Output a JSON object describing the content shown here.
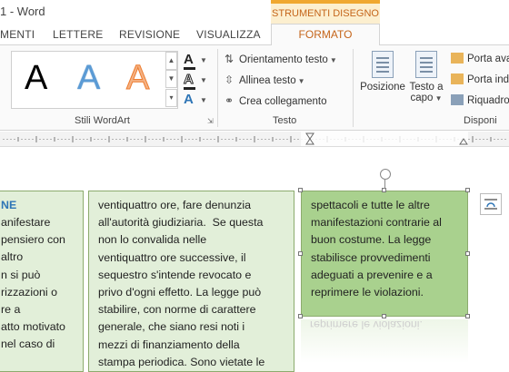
{
  "window": {
    "title": "1 - Word"
  },
  "context_group": "STRUMENTI DISEGNO",
  "tabs": [
    "MENTI",
    "LETTERE",
    "REVISIONE",
    "VISUALIZZA"
  ],
  "active_tab": "FORMATO",
  "ribbon": {
    "wordart": {
      "group_label": "Stili WordArt",
      "sample": "A"
    },
    "text": {
      "group_label": "Testo",
      "orientation": "Orientamento testo",
      "align": "Allinea testo",
      "link": "Crea collegamento"
    },
    "arrange": {
      "group_label": "Disponi",
      "position_label": "Posizione",
      "wrap_line1": "Testo a",
      "wrap_line2": "capo",
      "bring_forward": "Porta ava",
      "send_backward": "Porta ind",
      "selection_pane": "Riquadro"
    }
  },
  "document": {
    "left_box": {
      "heading": "NE",
      "lines": [
        "anifestare",
        "pensiero con",
        "altro",
        "n si può",
        "rizzazioni o",
        "re a",
        "atto motivato",
        "nel caso di"
      ]
    },
    "middle_box": {
      "lines": [
        "ventiquattro ore, fare denunzia",
        "all'autorità giudiziaria.  Se questa",
        "non lo convalida nelle",
        "ventiquattro ore successive, il",
        "sequestro s'intende revocato e",
        "privo d'ogni effetto. La legge può",
        "stabilire, con norme di carattere",
        "generale, che siano resi noti i",
        "mezzi di finanziamento della",
        "stampa periodica. Sono vietate le"
      ]
    },
    "right_box": {
      "lines": [
        "spettacoli e tutte le altre",
        "manifestazioni contrarie al",
        "buon costume. La legge",
        "stabilisce provvedimenti",
        "adeguati a prevenire e a",
        "reprimere le violazioni."
      ]
    }
  },
  "colors": {
    "accent_orange": "#c5651a",
    "box_fill": "#e2efd9",
    "box_selected_fill": "#a9d18e",
    "heading_blue": "#2e75b6"
  }
}
